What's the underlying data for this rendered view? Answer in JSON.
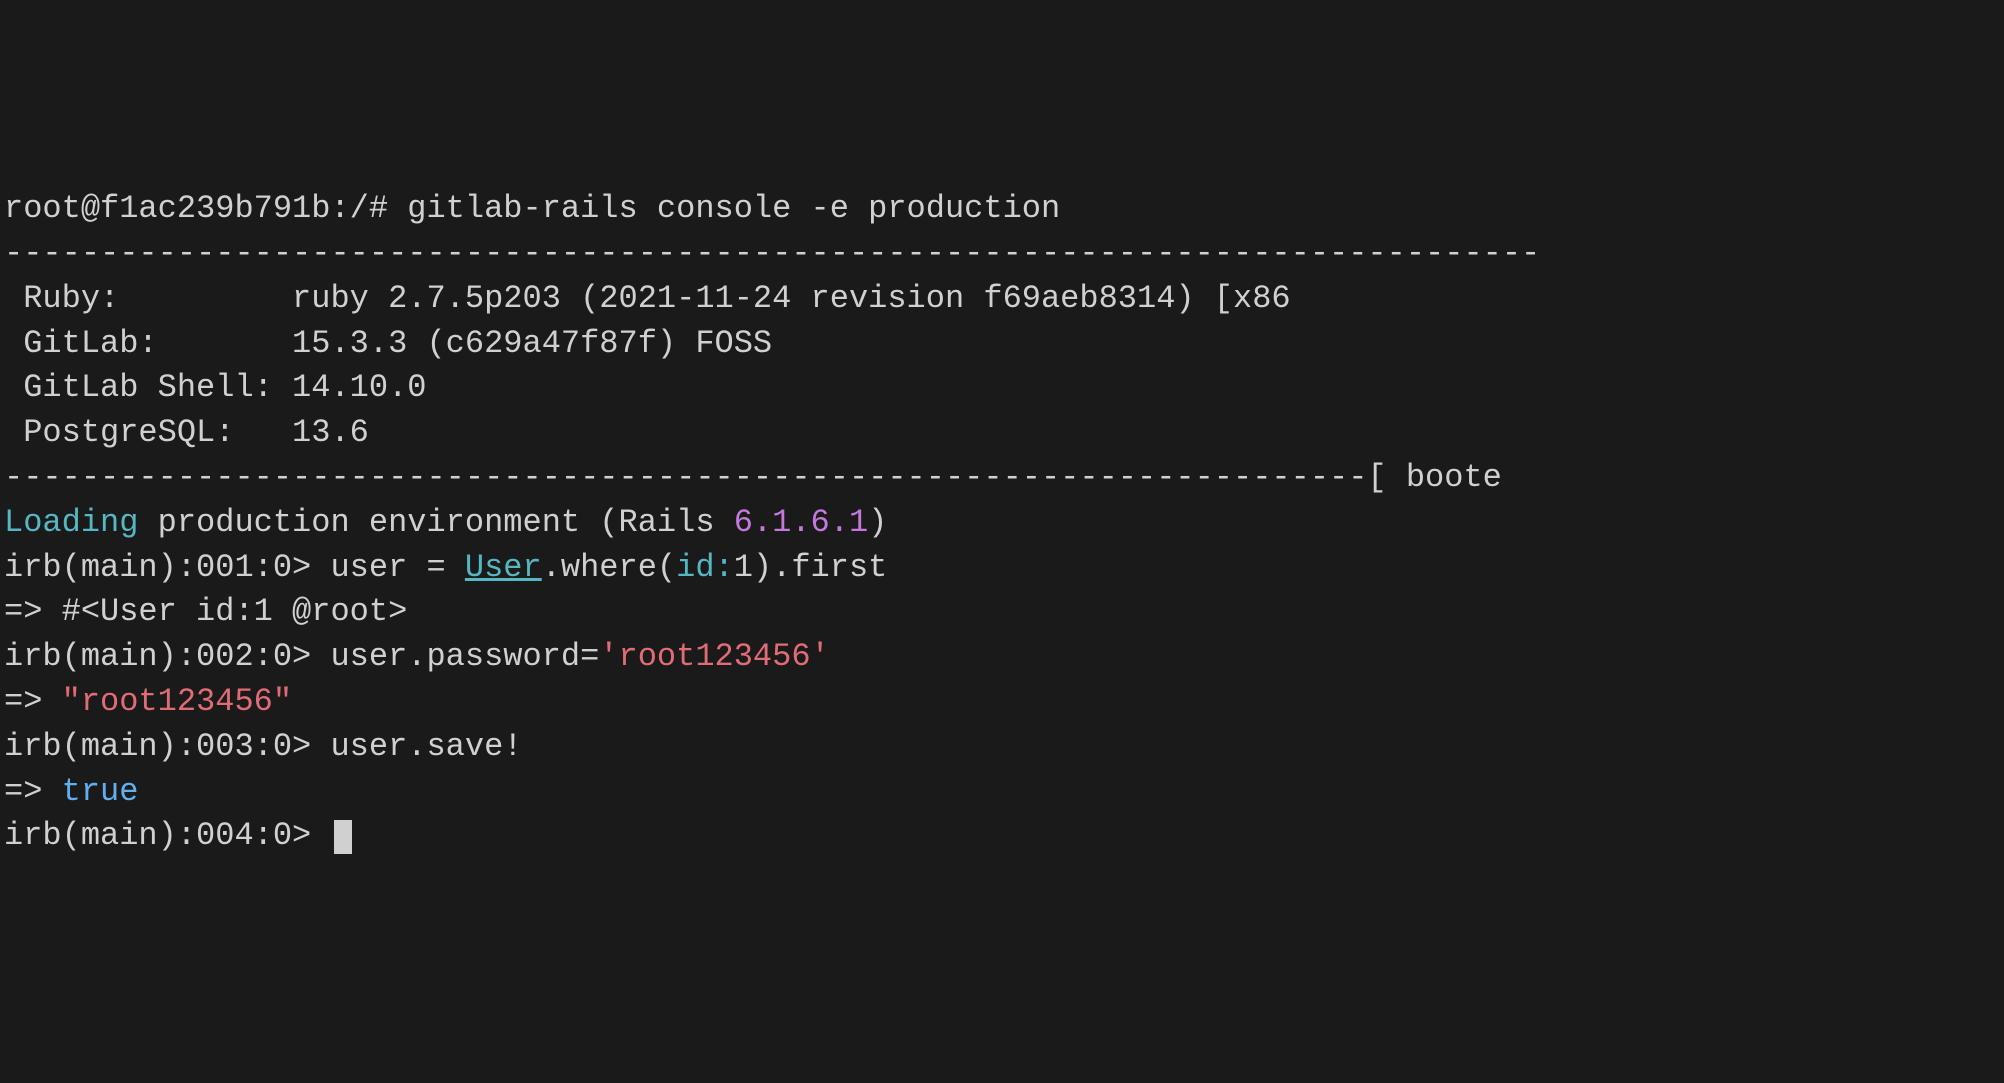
{
  "prompt_line": {
    "user_host": "root@f1ac239b791b",
    "path": ":/# ",
    "command": "gitlab-rails console -e production"
  },
  "divider_top": "--------------------------------------------------------------------------------",
  "info": {
    "ruby_label": " Ruby:         ",
    "ruby_value": "ruby 2.7.5p203 (2021-11-24 revision f69aeb8314) [x86",
    "gitlab_label": " GitLab:       ",
    "gitlab_value": "15.3.3 (c629a47f87f) FOSS",
    "shell_label": " GitLab Shell: ",
    "shell_value": "14.10.0",
    "pg_label": " PostgreSQL:   ",
    "pg_value": "13.6"
  },
  "divider_bottom": "-----------------------------------------------------------------------[ boote",
  "loading": {
    "word": "Loading",
    "rest1": " production environment (Rails ",
    "rails_ver": "6.1.6.1",
    "rest2": ")"
  },
  "irb1": {
    "prompt": "irb(main):001:0> ",
    "p1": "user = ",
    "user_class": "User",
    "p2": ".where(",
    "id_key": "id:",
    "p3": "1).first"
  },
  "result1": "=> #<User id:1 @root>",
  "irb2": {
    "prompt": "irb(main):002:0> ",
    "p1": "user.password=",
    "str": "'root123456'"
  },
  "result2": {
    "arrow": "=> ",
    "str": "\"root123456\""
  },
  "irb3": {
    "prompt": "irb(main):003:0> ",
    "cmd": "user.save!"
  },
  "result3": {
    "arrow": "=> ",
    "val": "true"
  },
  "irb4": {
    "prompt": "irb(main):004:0> "
  }
}
